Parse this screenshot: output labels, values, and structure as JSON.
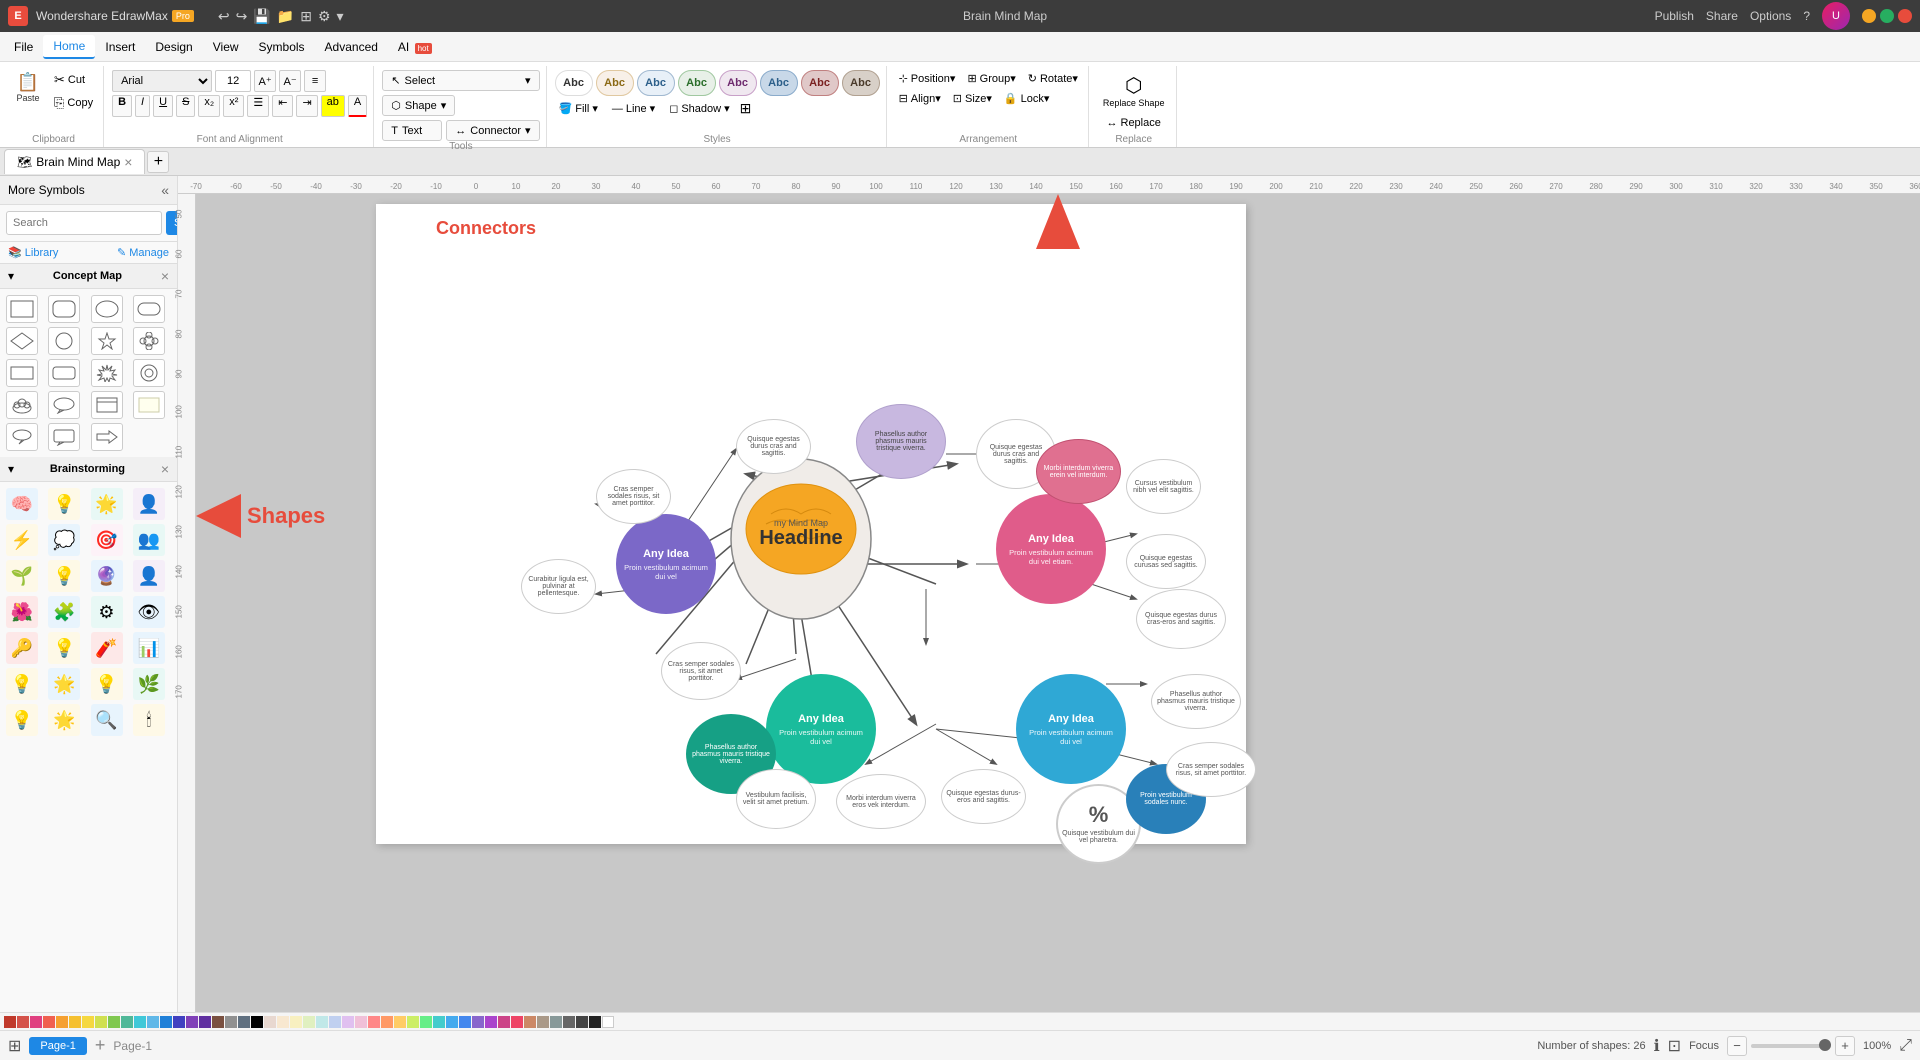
{
  "app": {
    "name": "Wondershare EdrawMax",
    "pro_badge": "Pro",
    "title": "Brain Mind Map",
    "version": "EdrawMax"
  },
  "title_bar": {
    "undo": "↩",
    "redo": "↪",
    "save": "💾",
    "open": "📁",
    "template": "⊞",
    "settings": "⚙",
    "more": "▾",
    "publish": "Publish",
    "share": "Share",
    "options": "Options",
    "help": "?",
    "min": "−",
    "max": "□",
    "close": "×"
  },
  "menu": {
    "items": [
      "File",
      "Home",
      "Insert",
      "Design",
      "View",
      "Symbols",
      "Advanced",
      "AI"
    ]
  },
  "ribbon": {
    "clipboard_label": "Clipboard",
    "font_label": "Font and Alignment",
    "tools_label": "Tools",
    "styles_label": "Styles",
    "fill_label": "Fill",
    "line_label": "Line",
    "shadow_label": "Shadow",
    "arrangement_label": "Arrangement",
    "replace_label": "Replace",
    "select_btn": "Select",
    "shape_btn": "Shape",
    "text_btn": "Text",
    "connector_btn": "Connector",
    "font_name": "Arial",
    "font_size": "12",
    "position_btn": "Position▾",
    "group_btn": "Group▾",
    "rotate_btn": "Rotate▾",
    "align_btn": "Align▾",
    "size_btn": "Size▾",
    "lock_btn": "Lock▾",
    "replace_shape_btn": "Replace Shape",
    "replace_btn": "Replace",
    "style_colors": [
      "#e8d5c4",
      "#f5e6d3",
      "#faebd7",
      "#e6d9c8",
      "#d4c5b0",
      "#c8b99a",
      "#b8a888",
      "#a09070"
    ],
    "fill_icon": "🎨",
    "line_icon": "—",
    "shadow_icon": "◻",
    "clipboard_paste": "📋",
    "clipboard_cut": "✂",
    "clipboard_copy": "⎘",
    "bold": "B",
    "italic": "I",
    "underline": "U",
    "strikethrough": "S",
    "bullet": "☰",
    "indent_inc": "⇥",
    "indent_dec": "⇤",
    "highlight": "A",
    "font_color": "A",
    "increase_font": "A+",
    "decrease_font": "A-",
    "align_icon": "≡"
  },
  "left_panel": {
    "title": "More Symbols",
    "search_placeholder": "Search",
    "search_btn": "Search",
    "library_label": "Library",
    "manage_label": "Manage",
    "concept_map_label": "Concept Map",
    "brainstorming_label": "Brainstorming",
    "shapes": [
      "rect",
      "rounded",
      "oval",
      "stadium",
      "diamond",
      "hexagon",
      "star",
      "flower",
      "rect2",
      "rounded2",
      "starburst",
      "ring",
      "cloud",
      "speech",
      "card",
      "sticky",
      "callout",
      "arrow",
      "double-arrow"
    ],
    "brainstorm_icons": [
      "🧠",
      "💡",
      "🌟",
      "👤",
      "⚡",
      "💭",
      "🎯",
      "👥",
      "🌱",
      "💡",
      "🔮",
      "👤",
      "🌺",
      "🧩",
      "⚙",
      "👁",
      "🔑",
      "💡",
      "🧨",
      "💡",
      "⚡",
      "🌟",
      "💡",
      "🌿",
      "💡",
      "🌟",
      "🔍",
      "🕯"
    ]
  },
  "tabs": {
    "doc_tab": "Brain Mind Map",
    "add_tab": "+"
  },
  "canvas": {
    "connectors_label": "Connectors",
    "up_arrow_indicator": true
  },
  "mind_map": {
    "headline": "Headline",
    "sub_title": "my Mind Map",
    "any_idea_1": {
      "title": "Any Idea",
      "subtitle": "Proin vestibulum acimum dui vel"
    },
    "any_idea_2": {
      "title": "Any Idea",
      "subtitle": "Proin vestibulum acimum dui vel etiam."
    },
    "any_idea_3": {
      "title": "Any Idea",
      "subtitle": "Proin vestibulum acimum dui vel"
    },
    "any_idea_4": {
      "title": "Any Idea",
      "subtitle": "Proin vestibulum acimum dui vel"
    },
    "nodes": [
      {
        "text": "Phasellus author phasmus mauris tristique viverra."
      },
      {
        "text": "Quisque egestas durus cras and sagittis."
      },
      {
        "text": "Cras semper sodales risus, sit amet porttitor."
      },
      {
        "text": "Cursus vestibulum nibh vel elit."
      },
      {
        "text": "Morbi interdum viverra erein vel interdum."
      },
      {
        "text": "Quisque egestas durus cras and sagittis."
      },
      {
        "text": "Cras semper sodales risus, sit amet porttitor."
      },
      {
        "text": "Quisque egestas curusas sed sagittis."
      },
      {
        "text": "Phasellus author phasmus mauris tristique viverra."
      },
      {
        "text": "Quisque egestas durus cras-eros and sagittis."
      },
      {
        "text": "Morbi interdum viverra eros vek interdum."
      },
      {
        "text": "Quisque egestas durus-eros and sagittis."
      },
      {
        "text": "Vestibulum facilisis, velit sit amet pretium."
      },
      {
        "text": "Cras semper sodales risus, sit amet porttitor."
      },
      {
        "text": "Phasellus author phasmus mauris tristique viverra."
      }
    ]
  },
  "status_bar": {
    "shapes_info": "Number of shapes: 26",
    "focus": "Focus",
    "zoom": "100%",
    "page_label": "Page-1",
    "layout_icon": "⊞",
    "fit_icon": "⊡",
    "zoom_out": "−",
    "zoom_in": "+"
  },
  "page_tabs": [
    "Page-1"
  ],
  "colors_palette": [
    "#c0392b",
    "#e74c3c",
    "#e91e63",
    "#ff5722",
    "#ff9800",
    "#ffc107",
    "#ffeb3b",
    "#8bc34a",
    "#4caf50",
    "#009688",
    "#00bcd4",
    "#03a9f4",
    "#2196f3",
    "#3f51b5",
    "#9c27b0",
    "#673ab7",
    "#795548",
    "#9e9e9e",
    "#607d8b",
    "#000000"
  ]
}
